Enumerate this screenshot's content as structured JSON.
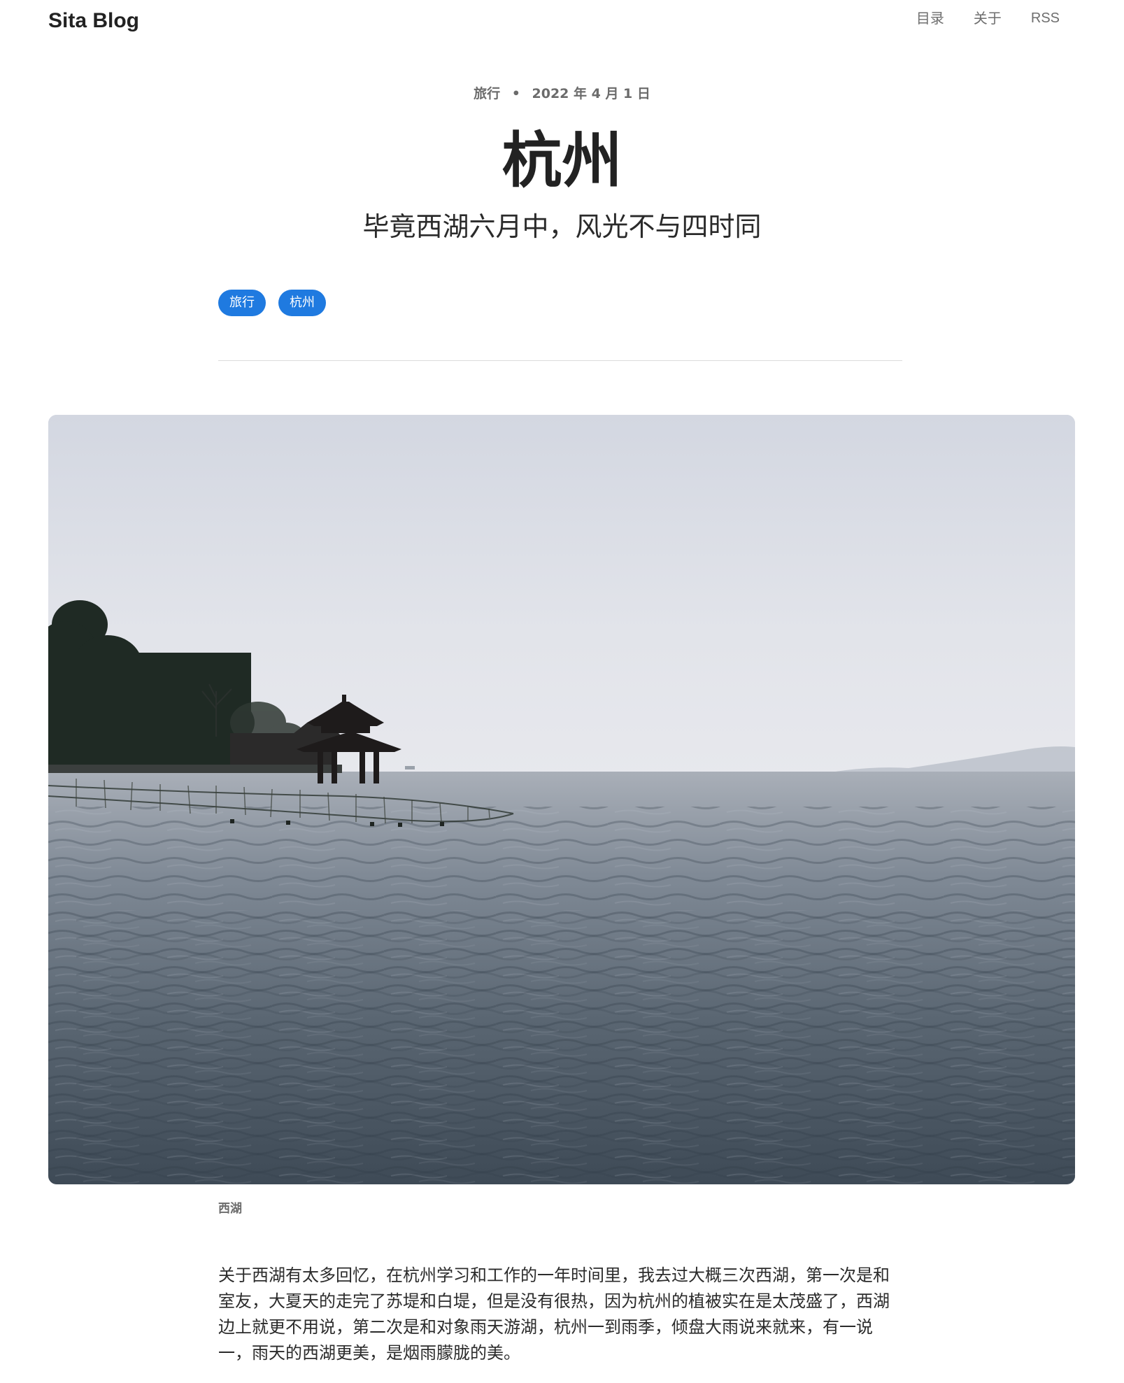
{
  "site": {
    "title": "Sita Blog",
    "nav": [
      "目录",
      "关于",
      "RSS"
    ]
  },
  "post": {
    "category": "旅行",
    "separator": "•",
    "date": "2022 年 4 月 1 日",
    "title": "杭州",
    "subtitle": "毕竟西湖六月中，风光不与四时同",
    "tags": [
      "旅行",
      "杭州"
    ],
    "figure": {
      "caption": "西湖"
    },
    "body": "关于西湖有太多回忆，在杭州学习和工作的一年时间里，我去过大概三次西湖，第一次是和室友，大夏天的走完了苏堤和白堤，但是没有很热，因为杭州的植被实在是太茂盛了，西湖边上就更不用说，第二次是和对象雨天游湖，杭州一到雨季，倾盘大雨说来就来，有一说一，雨天的西湖更美，是烟雨朦胧的美。"
  },
  "colors": {
    "tag_bg": "#1f7ae0",
    "nav_text": "#6e6e6e",
    "meta_text": "#6b6b6b",
    "sky": "#d8dbe3",
    "water": "#4a5663"
  }
}
